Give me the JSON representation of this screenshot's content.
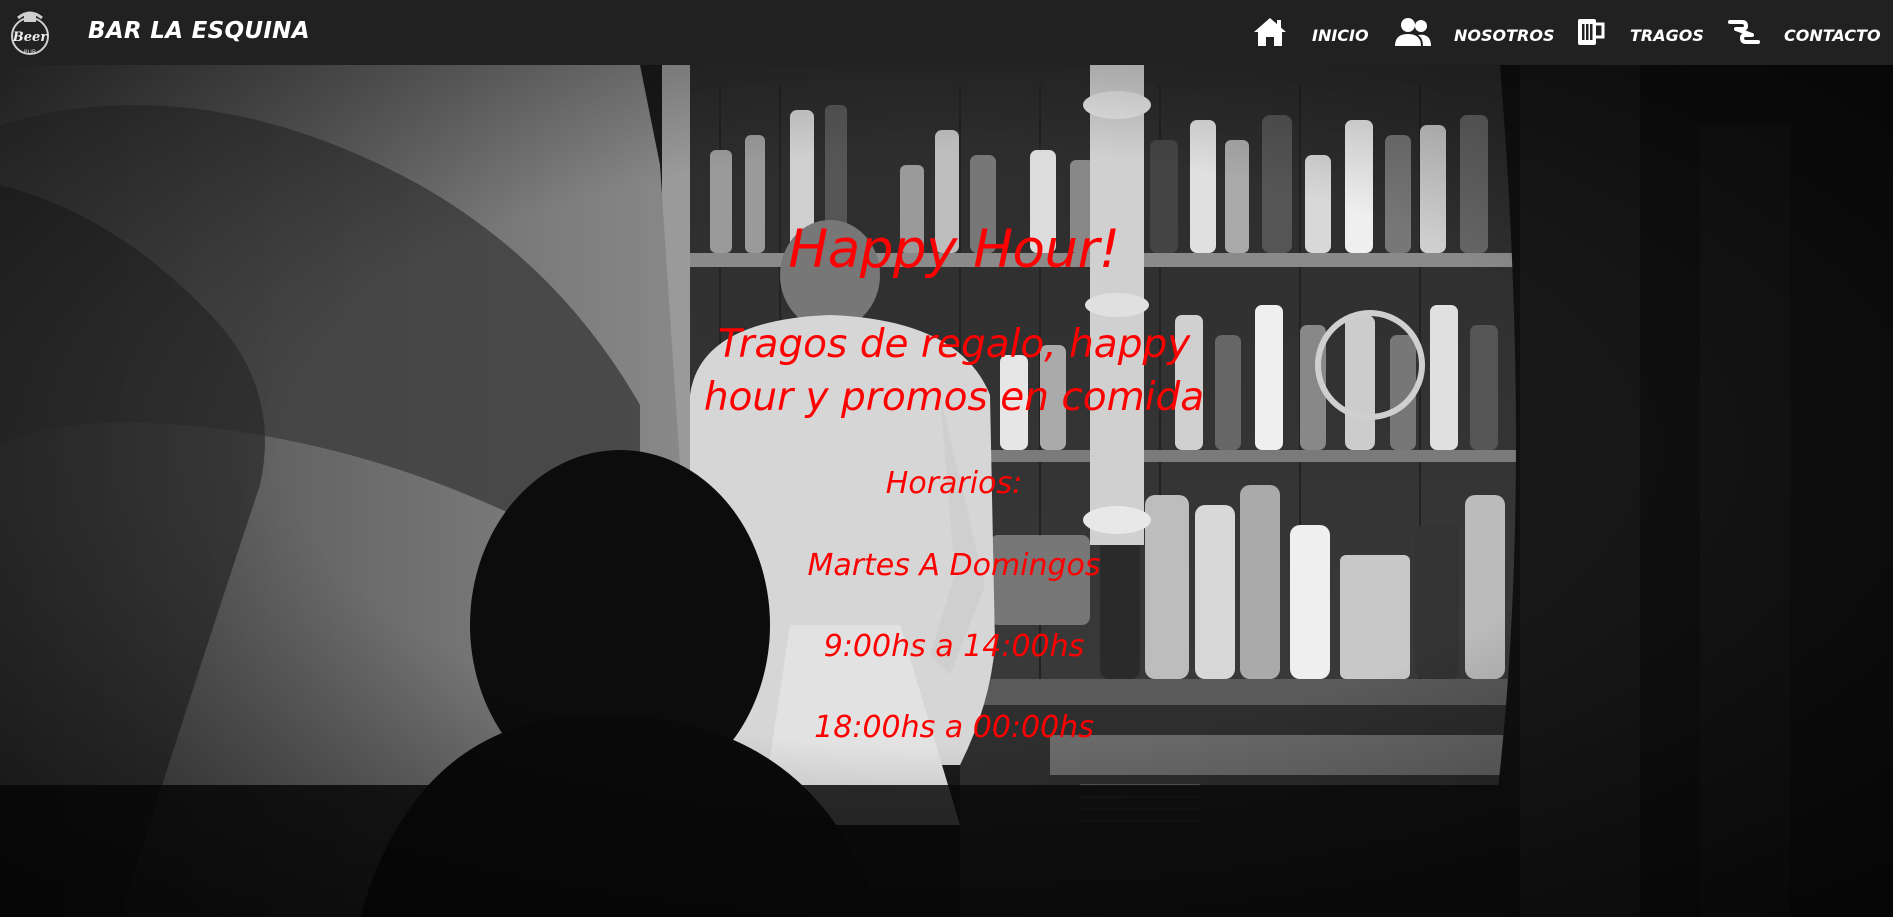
{
  "navbar": {
    "brand": "BAR LA ESQUINA",
    "logo_icon": "beer-logo-icon",
    "items": [
      {
        "label": "INICIO",
        "icon": "home-icon"
      },
      {
        "label": "NOSOTROS",
        "icon": "users-icon"
      },
      {
        "label": "TRAGOS",
        "icon": "beer-mug-icon"
      },
      {
        "label": "CONTACTO",
        "icon": "handshake-icon"
      }
    ]
  },
  "hero": {
    "title": "Happy Hour!",
    "subtitle": "Tragos de regalo, happy hour y promos en comida",
    "lines": [
      "Horarios:",
      "Martes A Domingos",
      "9:00hs a 14:00hs",
      "18:00hs a 00:00hs"
    ],
    "text_color": "#ff0000"
  },
  "colors": {
    "navbar_bg": "#212121",
    "nav_text": "#ffffff"
  }
}
